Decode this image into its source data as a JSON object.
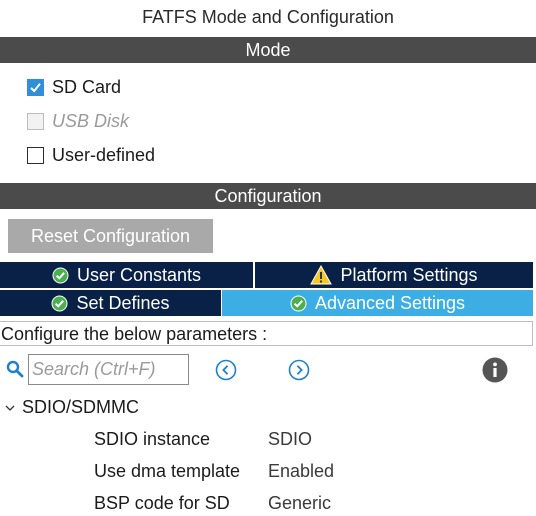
{
  "title": "FATFS Mode and Configuration",
  "mode": {
    "header": "Mode",
    "options": [
      {
        "label": "SD Card",
        "checked": true,
        "disabled": false
      },
      {
        "label": "USB Disk",
        "checked": false,
        "disabled": true
      },
      {
        "label": "User-defined",
        "checked": false,
        "disabled": false
      }
    ]
  },
  "configuration": {
    "header": "Configuration",
    "reset_label": "Reset Configuration",
    "tabs": [
      {
        "label": "User Constants",
        "icon": "check-circle-icon",
        "active": false
      },
      {
        "label": "Platform Settings",
        "icon": "warning-icon",
        "active": false
      },
      {
        "label": "Set Defines",
        "icon": "check-circle-icon",
        "active": false
      },
      {
        "label": "Advanced Settings",
        "icon": "check-circle-icon",
        "active": true
      }
    ],
    "hint": "Configure the below parameters :",
    "search_placeholder": "Search (Ctrl+F)",
    "group": {
      "label": "SDIO/SDMMC",
      "params": [
        {
          "name": "SDIO instance",
          "value": "SDIO"
        },
        {
          "name": "Use dma template",
          "value": "Enabled"
        },
        {
          "name": "BSP code for SD",
          "value": "Generic"
        }
      ]
    }
  },
  "colors": {
    "section_bar": "#4b4b4b",
    "tab_dark": "#0a2147",
    "tab_active": "#3daee3",
    "accent": "#2f8fd8",
    "check_green": "#4caf50",
    "warning_yellow": "#f6c623"
  }
}
